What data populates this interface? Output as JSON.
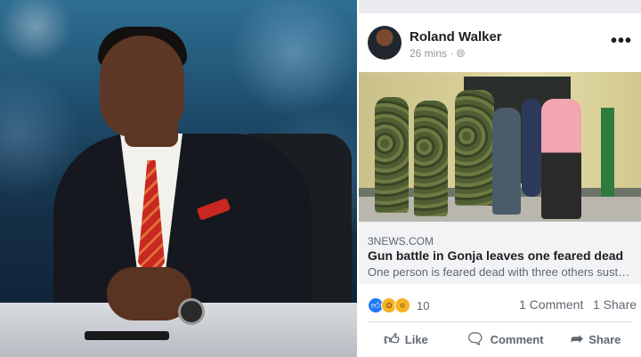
{
  "post": {
    "author": "Roland Walker",
    "time": "26 mins",
    "privacy_icon": "globe-icon",
    "menu_icon": "ellipsis-icon"
  },
  "link": {
    "domain": "3NEWS.COM",
    "title": "Gun battle in Gonja leaves one feared dead",
    "description": "One person is feared dead with three others sustainin..."
  },
  "reactions": {
    "count": "10",
    "types": [
      "like-icon",
      "haha-icon",
      "wow-icon"
    ]
  },
  "stats": {
    "comments": "1 Comment",
    "shares": "1 Share"
  },
  "actions": {
    "like": "Like",
    "comment": "Comment",
    "share": "Share"
  },
  "colors": {
    "facebook_blue": "#2078f4",
    "text_primary": "#1c1e21",
    "text_secondary": "#606770"
  }
}
